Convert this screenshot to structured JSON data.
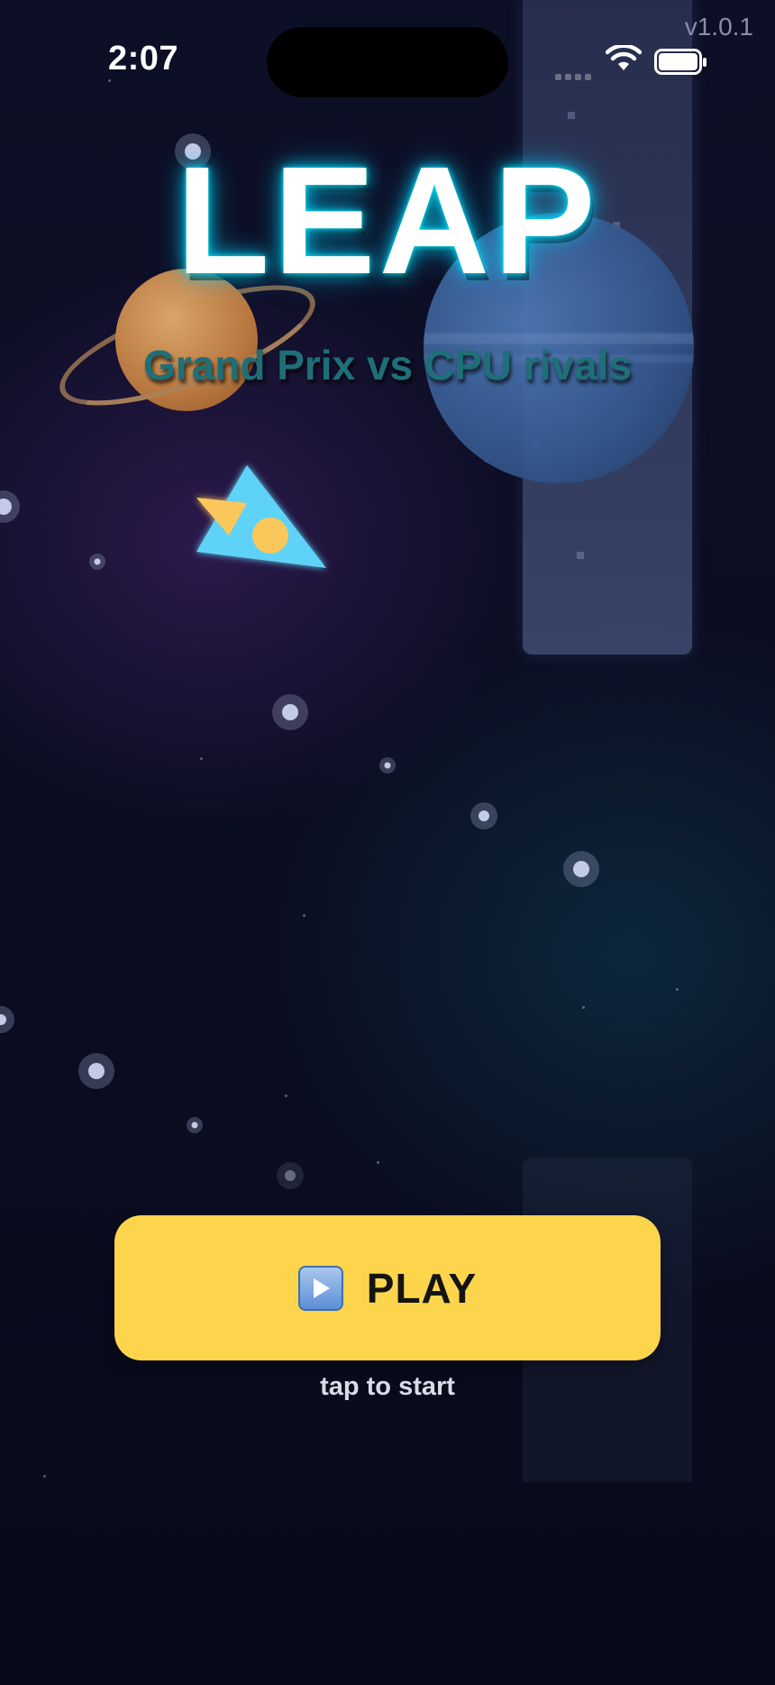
{
  "status_bar": {
    "time": "2:07",
    "icons": [
      "cellular-signal-icon",
      "wifi-icon",
      "battery-icon"
    ]
  },
  "version": "v1.0.1",
  "title": "LEAP",
  "subtitle": "Grand Prix vs CPU rivals",
  "play_button": {
    "icon": "play-icon",
    "label": "PLAY"
  },
  "hint": "tap to start",
  "colors": {
    "title_glow": "#00e5ff",
    "play_button": "#fdd54d",
    "ship_body": "#5fd3f7",
    "ship_accent": "#fcc75a",
    "background": "#0a0b1c"
  }
}
